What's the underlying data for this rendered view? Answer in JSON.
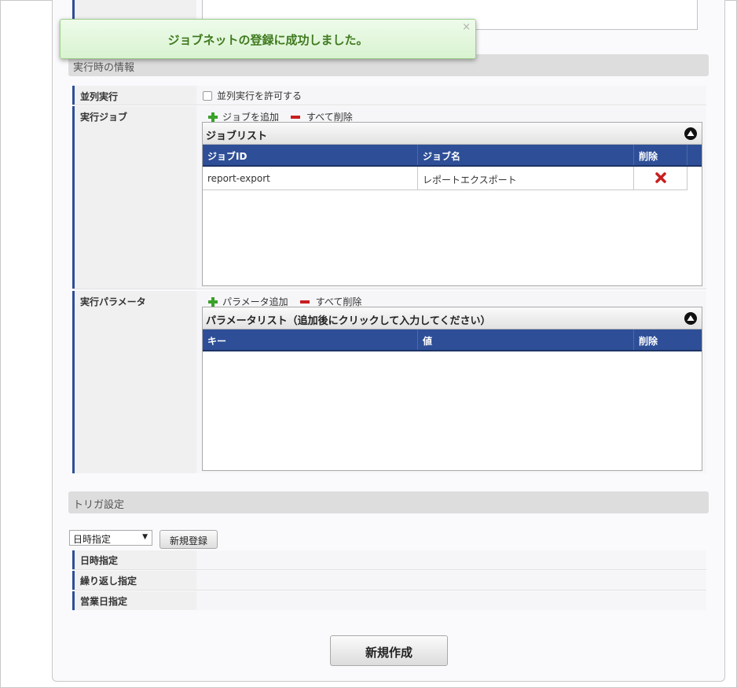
{
  "toast": {
    "message": "ジョブネットの登録に成功しました。",
    "close": "×"
  },
  "runtime_section": {
    "title": "実行時の情報",
    "parallel": {
      "label": "並列実行",
      "checkbox_label": "並列実行を許可する",
      "checked": false
    },
    "jobs": {
      "label": "実行ジョブ",
      "add_label": "ジョブを追加",
      "clear_label": "すべて削除",
      "grid_title": "ジョブリスト",
      "columns": [
        "ジョブID",
        "ジョブ名",
        "削除"
      ],
      "rows": [
        {
          "id": "report-export",
          "name": "レポートエクスポート"
        }
      ]
    },
    "params": {
      "label": "実行パラメータ",
      "add_label": "パラメータ追加",
      "clear_label": "すべて削除",
      "grid_title": "パラメータリスト（追加後にクリックして入力してください）",
      "columns": [
        "キー",
        "値",
        "削除"
      ]
    }
  },
  "trigger_section": {
    "title": "トリガ設定",
    "select_value": "日時指定",
    "register_button": "新規登録",
    "rows": [
      "日時指定",
      "繰り返し指定",
      "営業日指定"
    ]
  },
  "create_button": "新規作成",
  "colors": {
    "grid_header": "#2e4f97",
    "label_accent": "#2e4f97",
    "toast_text": "#3f7a1f",
    "add_icon": "#3aa12a",
    "remove_icon": "#c81e1e"
  }
}
